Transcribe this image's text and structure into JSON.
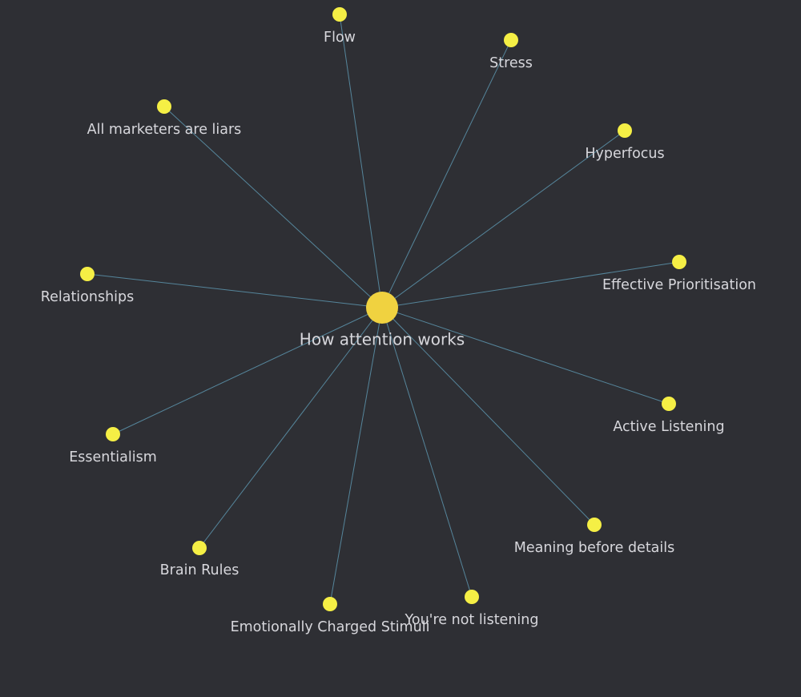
{
  "graph": {
    "background": "#2e2f34",
    "edge_color": "#5a8fa6",
    "node_color": "#f5ef45",
    "center_node_color": "#f0d240",
    "label_color": "#d7d7dc",
    "center": {
      "id": "how-attention-works",
      "label": "How attention works"
    },
    "nodes": [
      {
        "id": "flow",
        "label": "Flow"
      },
      {
        "id": "stress",
        "label": "Stress"
      },
      {
        "id": "all-marketers-are-liars",
        "label": "All marketers are liars"
      },
      {
        "id": "hyperfocus",
        "label": "Hyperfocus"
      },
      {
        "id": "relationships",
        "label": "Relationships"
      },
      {
        "id": "effective-prioritisation",
        "label": "Effective Prioritisation"
      },
      {
        "id": "active-listening",
        "label": "Active Listening"
      },
      {
        "id": "essentialism",
        "label": "Essentialism"
      },
      {
        "id": "meaning-before-details",
        "label": "Meaning before details"
      },
      {
        "id": "brain-rules",
        "label": "Brain Rules"
      },
      {
        "id": "emotionally-charged-stimuli",
        "label": "Emotionally Charged Stimuli"
      },
      {
        "id": "youre-not-listening",
        "label": "You're not listening"
      }
    ]
  }
}
